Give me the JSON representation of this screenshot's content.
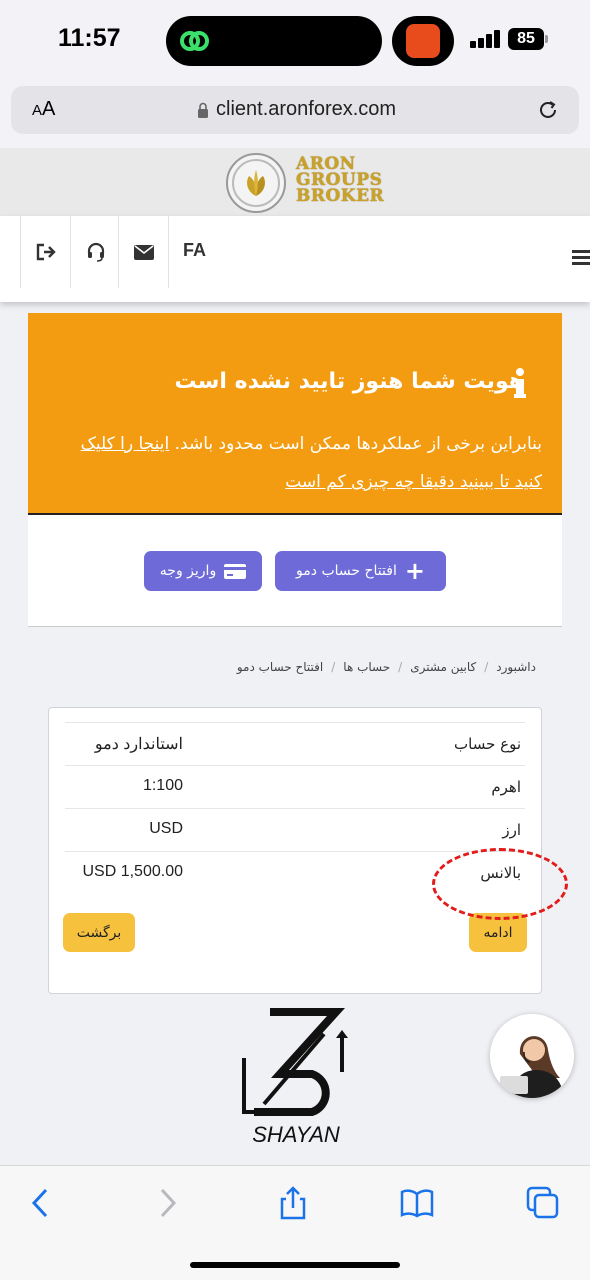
{
  "status_bar": {
    "time": "11:57",
    "battery": "85"
  },
  "browser": {
    "text_size_label_big": "A",
    "text_size_label_small": "A",
    "url": "client.aronforex.com"
  },
  "site": {
    "logo_lines": [
      "ARON",
      "GROUPS",
      "BROKER"
    ],
    "nav": {
      "lang": "FA"
    }
  },
  "alert": {
    "title": "هویت شما هنوز تایید نشده است",
    "body_text": "بنابراین برخی از عملکردها ممکن است محدود باشد.",
    "link_text": "اینجا را کلیک کنید تا ببینید دقیقا چه چیزی کم است",
    "color": "#f39c12"
  },
  "actions": {
    "open_demo": "افتتاح حساب دمو",
    "deposit": "واریز وجه",
    "color": "#6e6bd8"
  },
  "breadcrumb": [
    "داشبورد",
    "کابین مشتری",
    "حساب ها",
    "افتتاح حساب دمو"
  ],
  "account_table": {
    "rows": [
      {
        "label": "نوع حساب",
        "value": "استاندارد دمو"
      },
      {
        "label": "اهرم",
        "value": "1:100"
      },
      {
        "label": "ارز",
        "value": "USD"
      },
      {
        "label": "بالانس",
        "value": "USD 1,500.00"
      }
    ],
    "continue_label": "ادامه",
    "back_label": "برگشت",
    "button_color": "#f6c23e"
  },
  "watermark": {
    "text": "SHAYAN"
  }
}
